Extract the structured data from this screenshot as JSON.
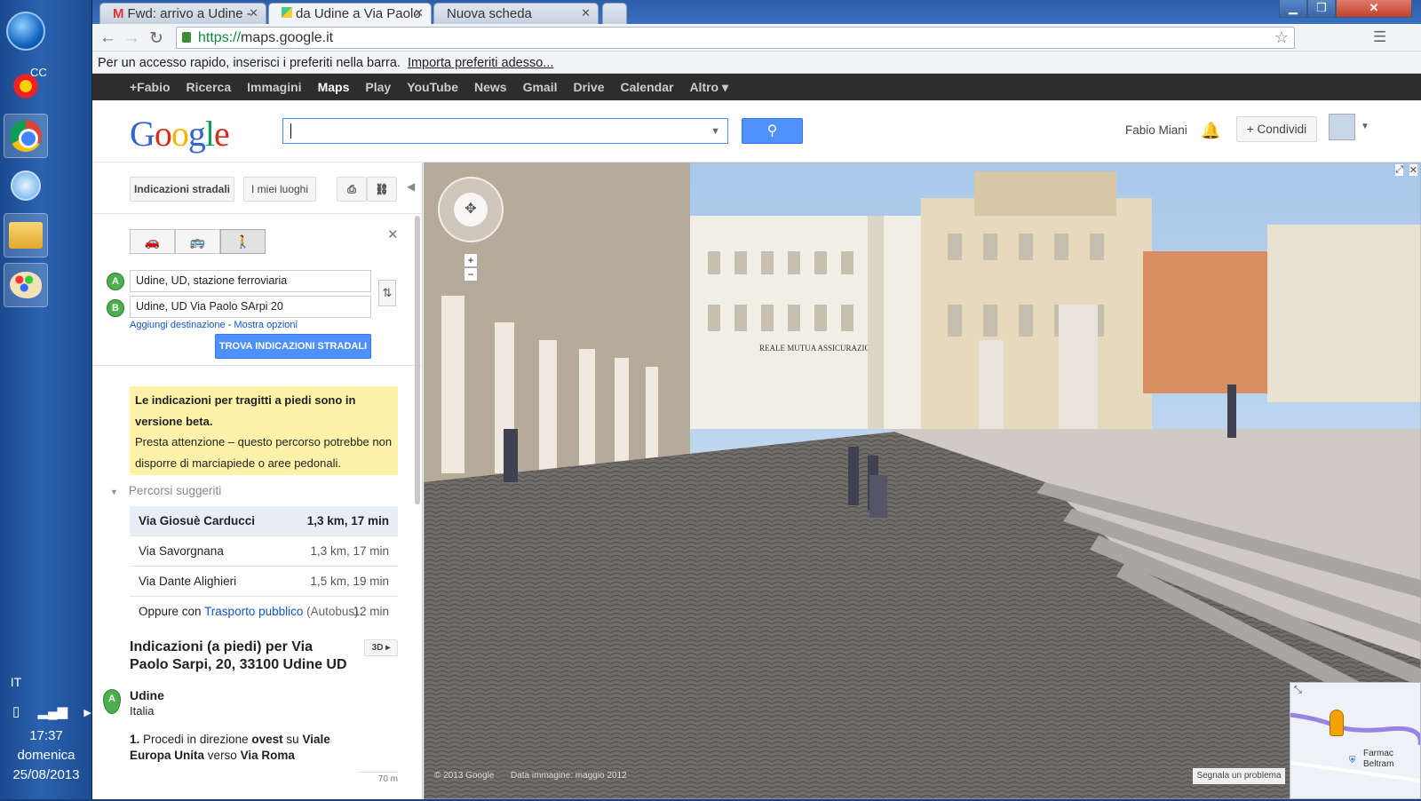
{
  "taskbar": {
    "lang": "IT",
    "time": "17:37",
    "day": "domenica",
    "date": "25/08/2013",
    "cc_label": "CC"
  },
  "browser": {
    "tabs": [
      {
        "label": "Fwd: arrivo a Udine -"
      },
      {
        "label": "da Udine a Via Paolo"
      },
      {
        "label": "Nuova scheda"
      }
    ],
    "url_scheme": "https://",
    "url_host": "maps.google.it",
    "bookmark_text": "Per un accesso rapido, inserisci i preferiti nella barra.",
    "bookmark_link": "Importa preferiti adesso..."
  },
  "gbar": [
    "+Fabio",
    "Ricerca",
    "Immagini",
    "Maps",
    "Play",
    "YouTube",
    "News",
    "Gmail",
    "Drive",
    "Calendar",
    "Altro ▾"
  ],
  "header": {
    "logo": "Google",
    "search_value": "",
    "user_name": "Fabio Miani",
    "share_label": "+ Condividi"
  },
  "panel": {
    "btn_directions": "Indicazioni stradali",
    "btn_places": "I miei luoghi",
    "marker_a": "A",
    "marker_b": "B",
    "origin": "Udine, UD, stazione ferroviaria",
    "destination": "Udine, UD Via Paolo SArpi 20",
    "add_dest": "Aggiungi destinazione",
    "separator": " - ",
    "show_options": "Mostra opzioni",
    "find_button": "TROVA INDICAZIONI STRADALI",
    "warning_bold": "Le indicazioni per tragitti a piedi sono in versione beta.",
    "warning_text": "Presta attenzione – questo percorso potrebbe non disporre di marciapiede o aree pedonali.",
    "suggested_title": "Percorsi suggeriti",
    "routes": [
      {
        "name": "Via Giosuè Carducci",
        "info": "1,3 km, 17 min"
      },
      {
        "name": "Via Savorgnana",
        "info": "1,3 km, 17 min"
      },
      {
        "name": "Via Dante Alighieri",
        "info": "1,5 km, 19 min"
      }
    ],
    "transit_prefix": "Oppure con",
    "transit_link": "Trasporto pubblico",
    "transit_mode": "(Autobus)",
    "transit_time": "12 min",
    "dir_title": "Indicazioni (a piedi) per Via Paolo Sarpi, 20, 33100 Udine UD",
    "btn_3d": "3D ▸",
    "start_city": "Udine",
    "start_country": "Italia",
    "step1_num": "1.",
    "step1_a": "Procedi in direzione",
    "step1_b": "ovest",
    "step1_c": "su",
    "step1_d": "Viale Europa Unita",
    "step1_e": "verso",
    "step1_f": "Via Roma",
    "step1_dist": "70 m"
  },
  "pano": {
    "zoom_in": "+",
    "zoom_out": "−",
    "building_sign": "REALE MUTUA ASSICURAZIONI",
    "copyright": "© 2013 Google",
    "image_date": "Data immagine: maggio 2012",
    "report": "Segnala un problema",
    "mini_place": "Farmac",
    "mini_place2": "Beltram"
  }
}
